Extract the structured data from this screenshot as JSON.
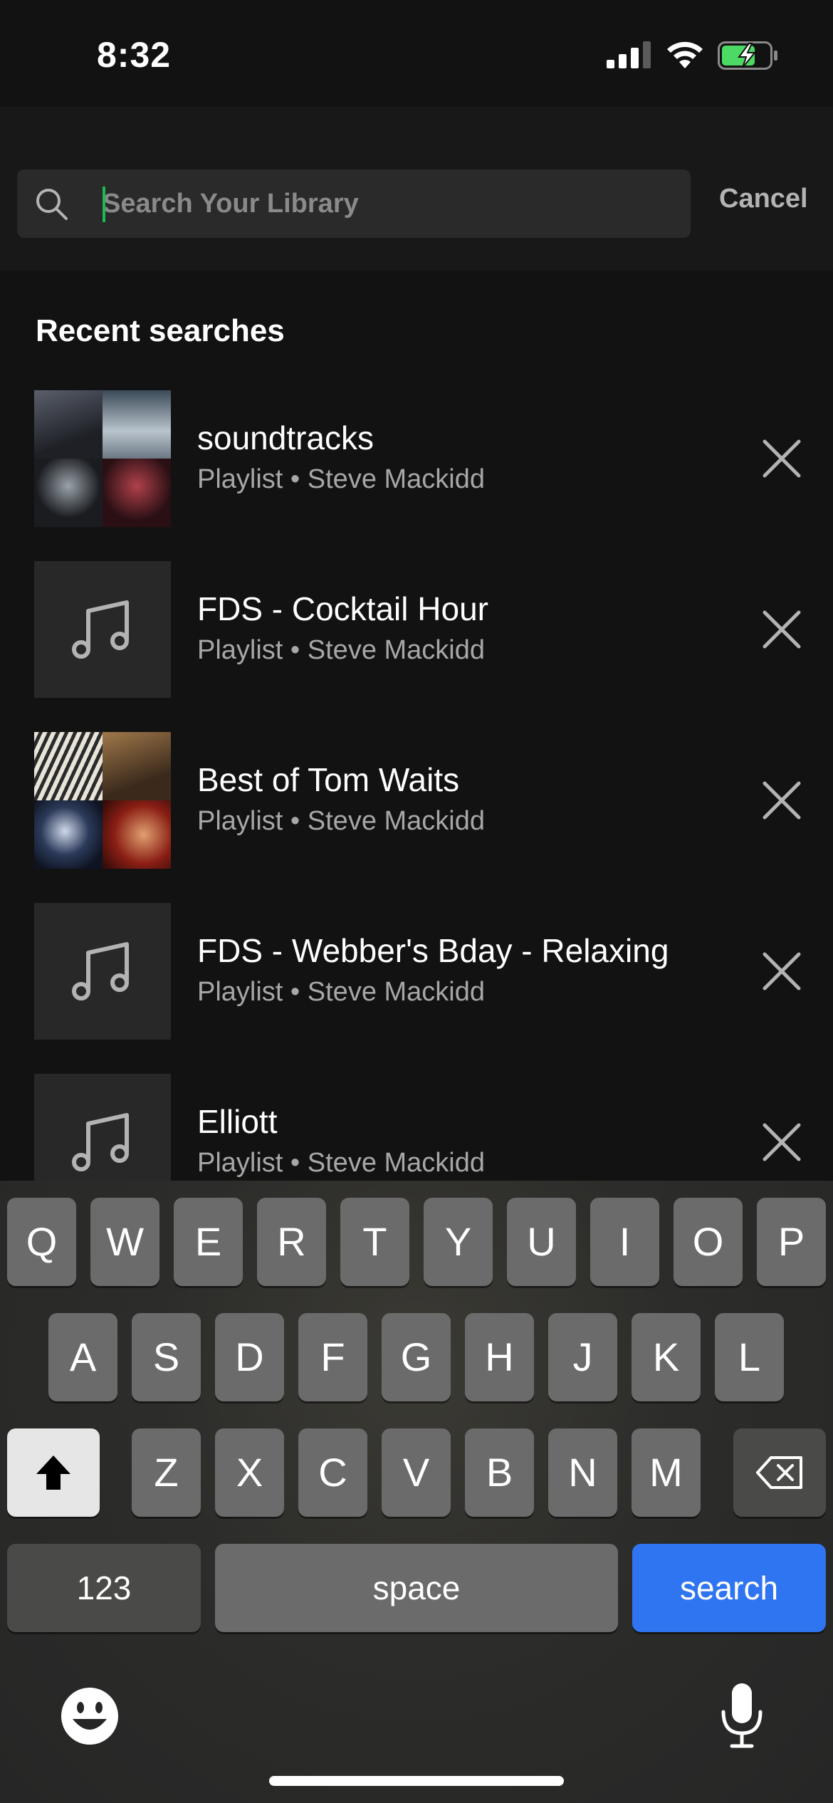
{
  "status_bar": {
    "time": "8:32"
  },
  "search": {
    "placeholder": "Search Your Library",
    "value": "",
    "cancel_label": "Cancel"
  },
  "recent": {
    "title": "Recent searches",
    "items": [
      {
        "title": "soundtracks",
        "subtitle": "Playlist • Steve Mackidd",
        "artwork": "mosaic"
      },
      {
        "title": "FDS - Cocktail Hour",
        "subtitle": "Playlist • Steve Mackidd",
        "artwork": "music-note"
      },
      {
        "title": "Best of Tom Waits",
        "subtitle": "Playlist • Steve Mackidd",
        "artwork": "mosaic"
      },
      {
        "title": "FDS - Webber's Bday - Relaxing",
        "subtitle": "Playlist • Steve Mackidd",
        "artwork": "music-note"
      },
      {
        "title": "Elliott",
        "subtitle": "Playlist • Steve Mackidd",
        "artwork": "music-note"
      }
    ]
  },
  "keyboard": {
    "row1": [
      "Q",
      "W",
      "E",
      "R",
      "T",
      "Y",
      "U",
      "I",
      "O",
      "P"
    ],
    "row2": [
      "A",
      "S",
      "D",
      "F",
      "G",
      "H",
      "J",
      "K",
      "L"
    ],
    "row3": [
      "Z",
      "X",
      "C",
      "V",
      "B",
      "N",
      "M"
    ],
    "numbers_label": "123",
    "space_label": "space",
    "search_label": "search"
  },
  "colors": {
    "background": "#121212",
    "accent": "#1db954",
    "search_key": "#2f74f0"
  }
}
